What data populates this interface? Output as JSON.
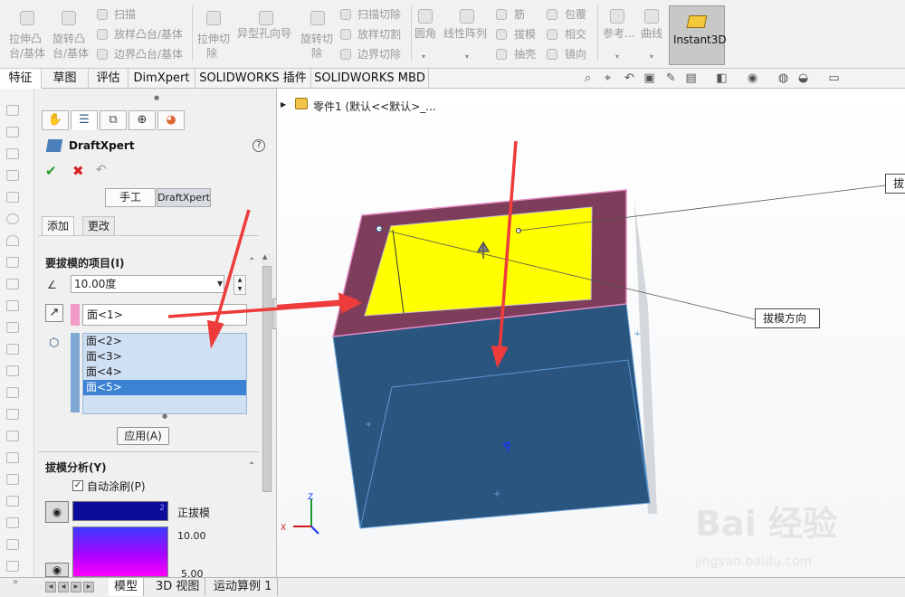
{
  "ribbon": {
    "groups": [
      {
        "items": [
          "拉伸凸",
          "台/基体"
        ]
      },
      {
        "items": [
          "旋转凸",
          "台/基体"
        ]
      },
      {
        "items": [
          "扫描",
          "放样凸台/基体",
          "边界凸台/基体"
        ]
      },
      {
        "items": [
          "拉伸切",
          "除"
        ]
      },
      {
        "items": [
          "异型孔向导"
        ]
      },
      {
        "items": [
          "旋转切",
          "除"
        ]
      },
      {
        "items": [
          "扫描切除",
          "放样切割",
          "边界切除"
        ]
      },
      {
        "items": [
          "圆角"
        ]
      },
      {
        "items": [
          "线性阵列"
        ]
      },
      {
        "items": [
          "筋",
          "拔模",
          "抽壳"
        ]
      },
      {
        "items": [
          "包覆",
          "相交",
          "镜向"
        ]
      },
      {
        "items": [
          "参考..."
        ]
      },
      {
        "items": [
          "曲线"
        ]
      }
    ],
    "instant3d": "Instant3D"
  },
  "command_tabs": [
    "特征",
    "草图",
    "评估",
    "DimXpert",
    "SOLIDWORKS 插件",
    "SOLIDWORKS MBD"
  ],
  "property_manager": {
    "title": "DraftXpert",
    "help": "?",
    "mode_manual": "手工",
    "mode_xpert": "DraftXpert",
    "sub_add": "添加",
    "sub_change": "更改",
    "section_items_title": "要拔模的项目(I)",
    "angle_value": "10.00度",
    "neutral_face": "面<1>",
    "draft_faces": [
      "面<2>",
      "面<3>",
      "面<4>",
      "面<5>"
    ],
    "selected_face_index": 3,
    "apply_label": "应用(A)",
    "section_analysis_title": "拔模分析(Y)",
    "autopaint_label": "自动涂刷(P)",
    "autopaint_checked": true,
    "positive_label": "正拔模",
    "positive_bar_value": "2",
    "gradient_max": "10.00",
    "gradient_min": "5.00"
  },
  "bottom_tabs": [
    "模型",
    "3D 视图",
    "运动算例 1"
  ],
  "viewport": {
    "breadcrumb": "零件1 (默认<<默认>_...",
    "callout_direction": "拔模方向",
    "callout_edge": "拔",
    "watermark": "Bai 经验",
    "watermark_url": "jingyan.baidu.com"
  },
  "colors": {
    "box_side": "#28547e",
    "box_top": "#7e3d5b",
    "neutral_face": "#ffff00",
    "arrow": "#ee3b3b",
    "selection": "#3c82d3",
    "accent_swatch": "#f29ac8"
  }
}
